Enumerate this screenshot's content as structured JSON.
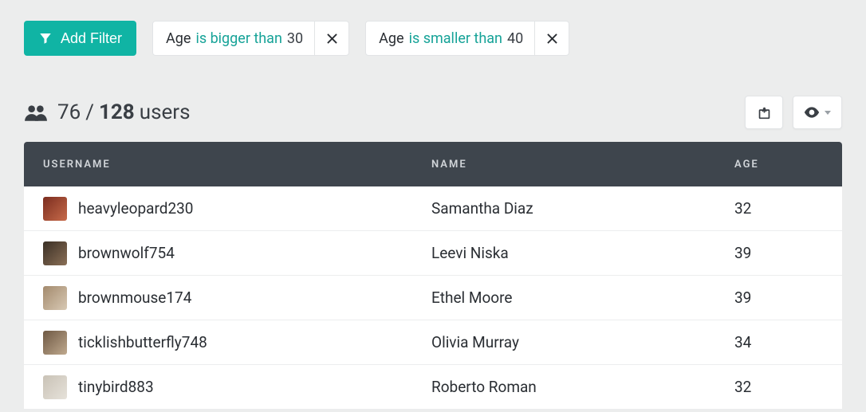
{
  "filterBar": {
    "addFilterLabel": "Add Filter",
    "chips": [
      {
        "field": "Age",
        "operator": "is bigger than",
        "value": "30"
      },
      {
        "field": "Age",
        "operator": "is smaller than",
        "value": "40"
      }
    ]
  },
  "header": {
    "filtered": "76",
    "total": "128",
    "unit": "users"
  },
  "table": {
    "columns": {
      "username": "USERNAME",
      "name": "NAME",
      "age": "AGE"
    },
    "rows": [
      {
        "username": "heavyleopard230",
        "name": "Samantha Diaz",
        "age": "32"
      },
      {
        "username": "brownwolf754",
        "name": "Leevi Niska",
        "age": "39"
      },
      {
        "username": "brownmouse174",
        "name": "Ethel Moore",
        "age": "39"
      },
      {
        "username": "ticklishbutterfly748",
        "name": "Olivia Murray",
        "age": "34"
      },
      {
        "username": "tinybird883",
        "name": "Roberto Roman",
        "age": "32"
      }
    ]
  }
}
